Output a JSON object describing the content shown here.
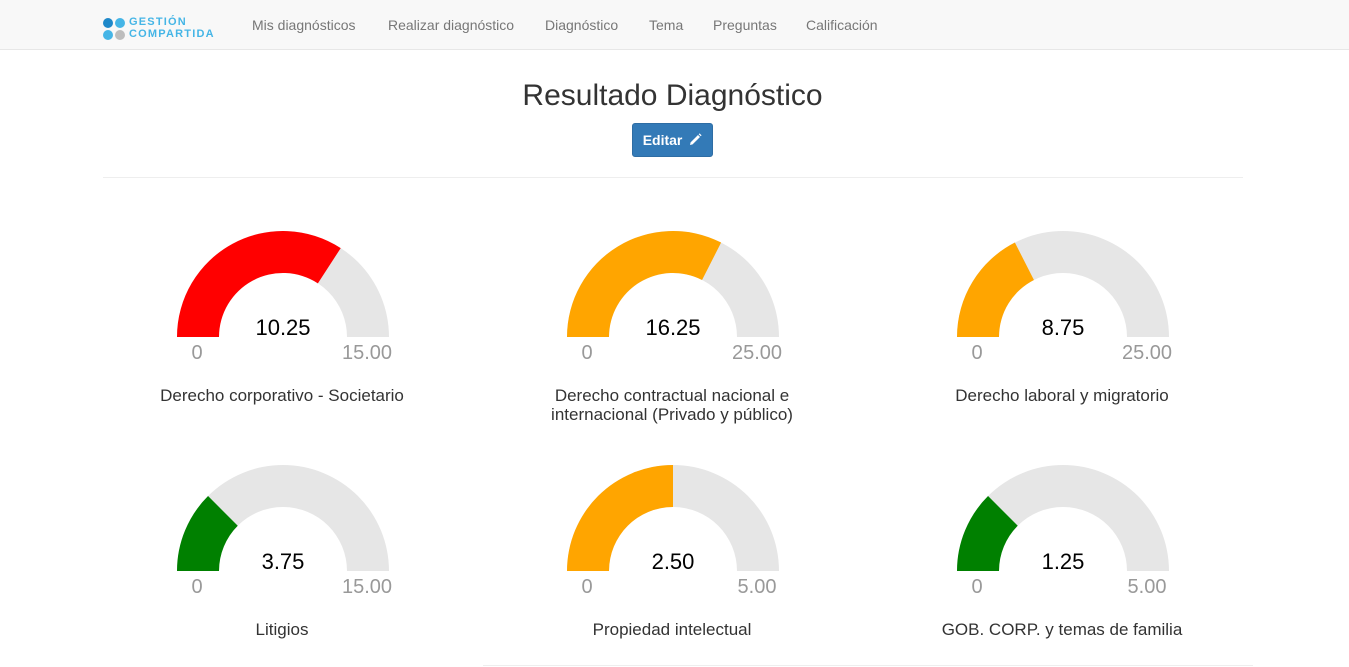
{
  "navbar": {
    "logo": {
      "line1": "GESTIÓN",
      "line2": "COMPARTIDA",
      "brand_color": "#45b5e6"
    },
    "items": [
      {
        "label": "Mis diagnósticos"
      },
      {
        "label": "Realizar diagnóstico"
      },
      {
        "label": "Diagnóstico"
      },
      {
        "label": "Tema"
      },
      {
        "label": "Preguntas"
      },
      {
        "label": "Calificación"
      }
    ]
  },
  "page": {
    "title": "Resultado Diagnóstico",
    "edit_button": {
      "label": "Editar",
      "icon": "pencil-icon"
    }
  },
  "gauges": [
    {
      "value": 10.25,
      "value_text": "10.25",
      "min_text": "0",
      "max": 15,
      "max_text": "15.00",
      "color": "#ff0000",
      "label": "Derecho corporativo - Societario"
    },
    {
      "value": 16.25,
      "value_text": "16.25",
      "min_text": "0",
      "max": 25,
      "max_text": "25.00",
      "color": "#ffa500",
      "label": "Derecho contractual nacional e internacional (Privado y público)"
    },
    {
      "value": 8.75,
      "value_text": "8.75",
      "min_text": "0",
      "max": 25,
      "max_text": "25.00",
      "color": "#ffa500",
      "label": "Derecho laboral y migratorio"
    },
    {
      "value": 3.75,
      "value_text": "3.75",
      "min_text": "0",
      "max": 15,
      "max_text": "15.00",
      "color": "#008000",
      "label": "Litigios"
    },
    {
      "value": 2.5,
      "value_text": "2.50",
      "min_text": "0",
      "max": 5,
      "max_text": "5.00",
      "color": "#ffa500",
      "label": "Propiedad intelectual"
    },
    {
      "value": 1.25,
      "value_text": "1.25",
      "min_text": "0",
      "max": 5,
      "max_text": "5.00",
      "color": "#008000",
      "label": "GOB. CORP. y temas de familia"
    }
  ],
  "colors": {
    "track": "#e6e6e6",
    "button": "#337ab7"
  }
}
